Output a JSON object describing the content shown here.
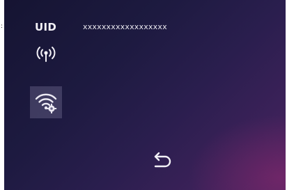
{
  "edge_mark": ":",
  "device": {
    "uid_label": "UID",
    "uid_value": "xxxxxxxxxxxxxxxxxx"
  },
  "icons": {
    "signal": "signal-broadcast-icon",
    "wifi": "wifi-settings-icon",
    "back": "back-arrow-icon"
  },
  "colors": {
    "background_dark": "#151432",
    "background_accent": "#4e2462",
    "text": "#f3f1f7",
    "tile": "#5f5c80"
  }
}
